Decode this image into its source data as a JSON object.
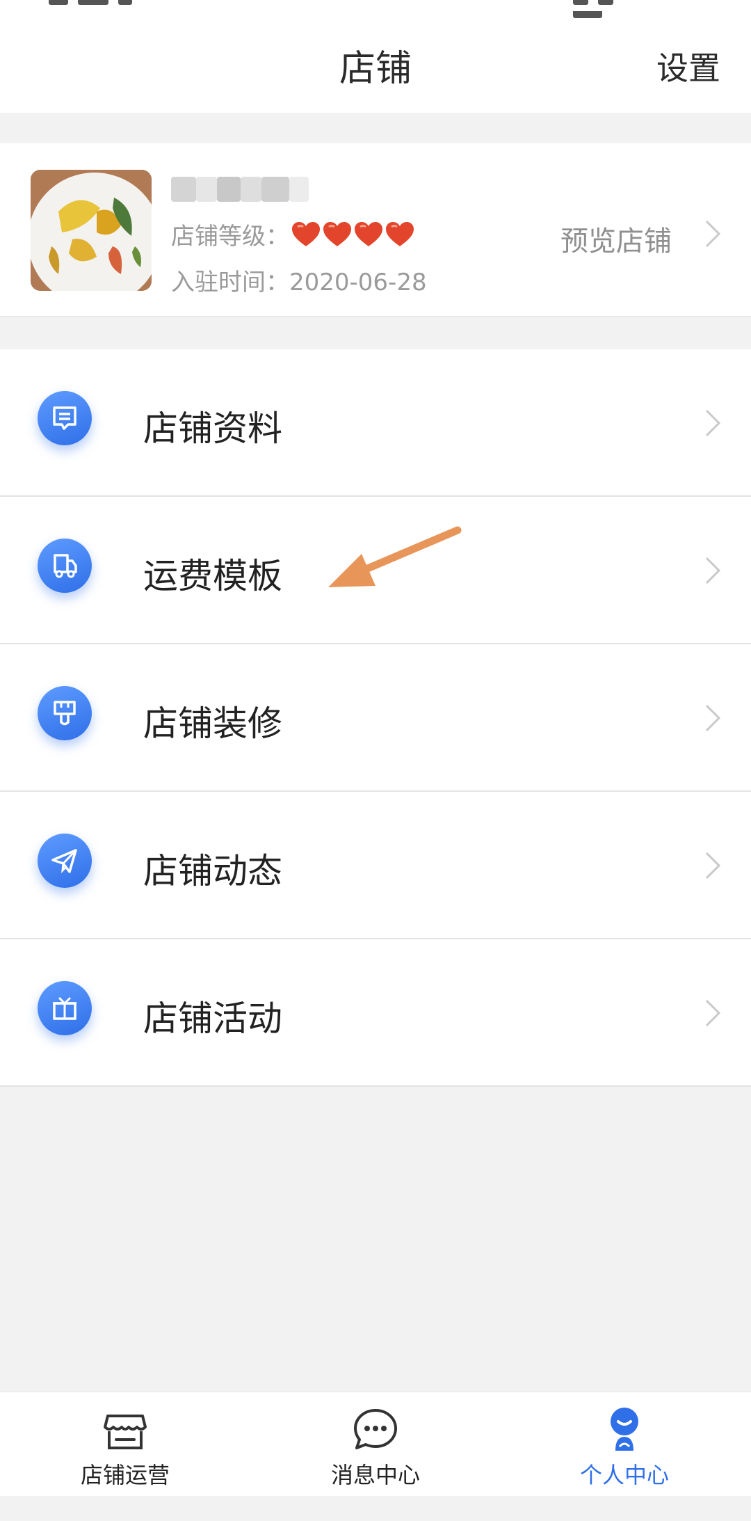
{
  "header": {
    "title": "店铺",
    "settings_label": "设置"
  },
  "store": {
    "level_label": "店铺等级：",
    "level_hearts": 4,
    "join_label": "入驻时间：",
    "join_date": "2020-06-28",
    "preview_label": "预览店铺"
  },
  "menu": {
    "items": [
      {
        "label": "店铺资料",
        "icon": "document-icon"
      },
      {
        "label": "运费模板",
        "icon": "truck-icon"
      },
      {
        "label": "店铺装修",
        "icon": "paint-brush-icon"
      },
      {
        "label": "店铺动态",
        "icon": "paper-plane-icon"
      },
      {
        "label": "店铺活动",
        "icon": "gift-icon"
      }
    ]
  },
  "bottom_nav": {
    "items": [
      {
        "label": "店铺运营",
        "icon": "store-icon",
        "active": false
      },
      {
        "label": "消息中心",
        "icon": "chat-bubble-icon",
        "active": false
      },
      {
        "label": "个人中心",
        "icon": "person-icon",
        "active": true
      }
    ]
  },
  "colors": {
    "accent": "#2f6fe8",
    "heart": "#e2452b",
    "annotation_arrow": "#e8955a"
  }
}
